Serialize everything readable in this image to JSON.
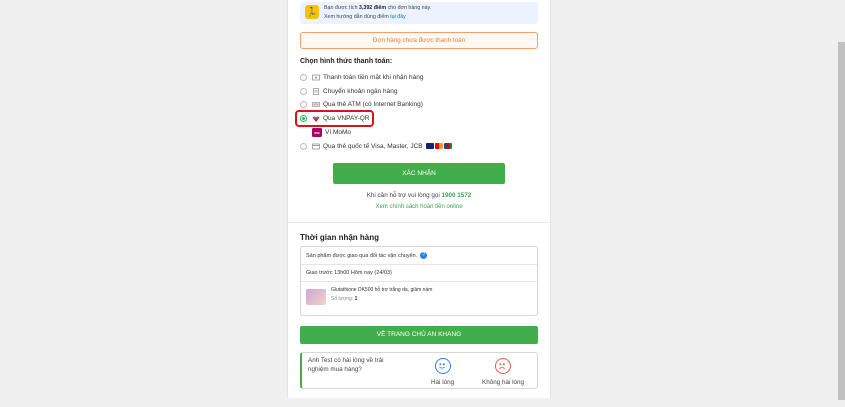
{
  "promo": {
    "line1_pre": "Bạn được tích ",
    "line1_points": "3,392 điểm",
    "line1_post": " cho đơn hàng này.",
    "line2_pre": "Xem hướng dẫn dùng điểm ",
    "line2_link": "tại đây"
  },
  "warning": "Đơn hàng chưa được thanh toán",
  "payment": {
    "title": "Chọn hình thức thanh toán:",
    "options": [
      {
        "label": "Thanh toán tiền mặt khi nhận hàng",
        "selected": false
      },
      {
        "label": "Chuyển khoản ngân hàng",
        "selected": false
      },
      {
        "label": "Qua thẻ ATM (có Internet Banking)",
        "selected": false
      },
      {
        "label": "Qua VNPAY-QR",
        "selected": true
      },
      {
        "label": "Ví MoMo",
        "selected": false
      },
      {
        "label": "Qua thẻ quốc tế Visa, Master, JCB",
        "selected": false
      }
    ],
    "confirm_label": "XÁC NHẬN"
  },
  "support": {
    "text": "Khi cần hỗ trợ vui lòng gọi ",
    "phone": "1900 1572",
    "refund_link": "Xem chính sách hoàn tiền online"
  },
  "delivery": {
    "title": "Thời gian nhận hàng",
    "partner_note": "Sản phẩm được giao qua đối tác vận chuyển.",
    "eta": "Giao trước 13h00 Hôm nay (24/03)",
    "product_name": "Glutathione DK500 hỗ trợ trắng da, giảm nám",
    "quantity_label": "Số lượng: ",
    "quantity": "1"
  },
  "home_button": "VỀ TRANG CHỦ AN KHANG",
  "feedback": {
    "question": "Anh Test có hài lòng về trải nghiệm mua hàng?",
    "happy": "Hài lòng",
    "unhappy": "Không hài lòng"
  },
  "colors": {
    "accent_green": "#40ae49",
    "warning_orange": "#e6803a",
    "highlight_red": "#d9141d",
    "link_blue": "#1a73e8"
  },
  "icons": {
    "promo": "runner-icon",
    "cash": "cash-icon",
    "bank": "bank-transfer-icon",
    "atm": "atm-card-icon",
    "vnpay": "vnpay-icon",
    "momo": "momo-icon",
    "intl": "credit-card-icon",
    "info": "info-icon",
    "happy": "smiley-happy-icon",
    "unhappy": "smiley-sad-icon"
  }
}
